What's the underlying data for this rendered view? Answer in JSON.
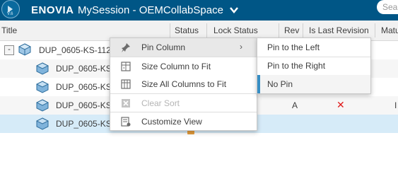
{
  "topbar": {
    "brand": "ENOVIA",
    "session": "MySession - OEMCollabSpace",
    "search_placeholder": "Sea",
    "compass_icon": "compass-icon",
    "colors": {
      "bar": "#005686"
    }
  },
  "table": {
    "columns": [
      "Title",
      "Status",
      "Lock Status",
      "Rev",
      "Is Last Revision",
      "Matu"
    ],
    "rows": [
      {
        "name": "DUP_0605-KS-112",
        "expander": "-",
        "rev": "",
        "last_rev": "",
        "last": ""
      },
      {
        "name": "DUP_0605-KS",
        "rev": "",
        "last_rev": "",
        "last": ""
      },
      {
        "name": "DUP_0605-KS",
        "rev": "",
        "last_rev": "",
        "last": ""
      },
      {
        "name": "DUP_0605-KS",
        "rev": "A",
        "last_rev": "✕",
        "last": "I"
      },
      {
        "name": "DUP_0605-KS",
        "rev": "",
        "last_rev": "",
        "last": ""
      }
    ]
  },
  "context_menu": {
    "items": [
      {
        "label": "Pin Column",
        "icon": "pin-icon",
        "has_submenu": true,
        "submenu_arrow": "›"
      },
      {
        "label": "Size Column to Fit",
        "icon": "size-column-icon"
      },
      {
        "label": "Size All Columns to Fit",
        "icon": "size-all-columns-icon"
      },
      {
        "label": "Clear Sort",
        "icon": "clear-sort-icon",
        "disabled": true
      },
      {
        "label": "Customize View",
        "icon": "customize-view-icon"
      }
    ]
  },
  "submenu": {
    "items": [
      {
        "label": "Pin to the Left"
      },
      {
        "label": "Pin to the Right"
      },
      {
        "label": "No Pin",
        "selected": true
      }
    ]
  }
}
